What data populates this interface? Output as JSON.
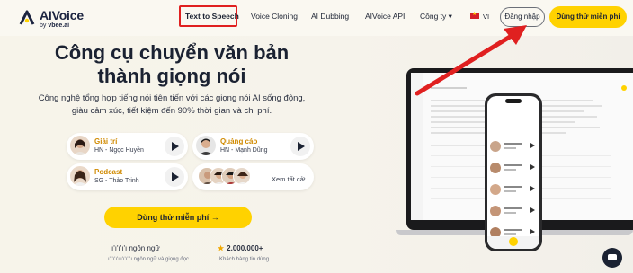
{
  "brand": {
    "name": "AIVoice",
    "sub_prefix": "by",
    "sub_brand": "vbee.ai"
  },
  "nav": {
    "items": [
      {
        "label": "Text to Speech",
        "active": true
      },
      {
        "label": "Voice Cloning"
      },
      {
        "label": "AI Dubbing"
      },
      {
        "label": "AIVoice API"
      },
      {
        "label": "Công ty ▾"
      }
    ],
    "language": "VI",
    "login": "Đăng nhập",
    "try_free": "Dùng thử miễn phí"
  },
  "hero": {
    "title_line1": "Công cụ chuyển văn bản",
    "title_line2": "thành giọng nói",
    "subtitle_line1": "Công nghệ tổng hợp tiếng nói tiên tiến với các giọng nói AI sống động,",
    "subtitle_line2": "giàu cảm xúc, tiết kiệm đến 90% thời gian và chi phí.",
    "voices": [
      {
        "category": "Giải trí",
        "voice": "HN - Ngọc Huyền"
      },
      {
        "category": "Quảng cáo",
        "voice": "HN - Mạnh Dũng"
      },
      {
        "category": "Podcast",
        "voice": "SG - Thảo Trinh"
      }
    ],
    "see_all": "Xem tất cả",
    "cta": "Dùng thử miễn phí →",
    "stats": {
      "languages_value": "ı'ı'ı'ı'ı ngôn ngữ",
      "languages_caption": "ı'ı'ı'ı'ı'ı'ı'ı'ı'ı ngôn ngữ và giọng đọc",
      "customers_value": "2.000.000+",
      "customers_caption": "Khách hàng tin dùng"
    }
  },
  "colors": {
    "accent": "#ffd200",
    "highlight_box": "#e02020",
    "arrow": "#e02020",
    "voice_category": "#d08a00"
  },
  "icons": {
    "play": "play-icon",
    "arrow_right": "arrow-right-icon",
    "star": "star-icon",
    "chat": "chat-icon"
  }
}
